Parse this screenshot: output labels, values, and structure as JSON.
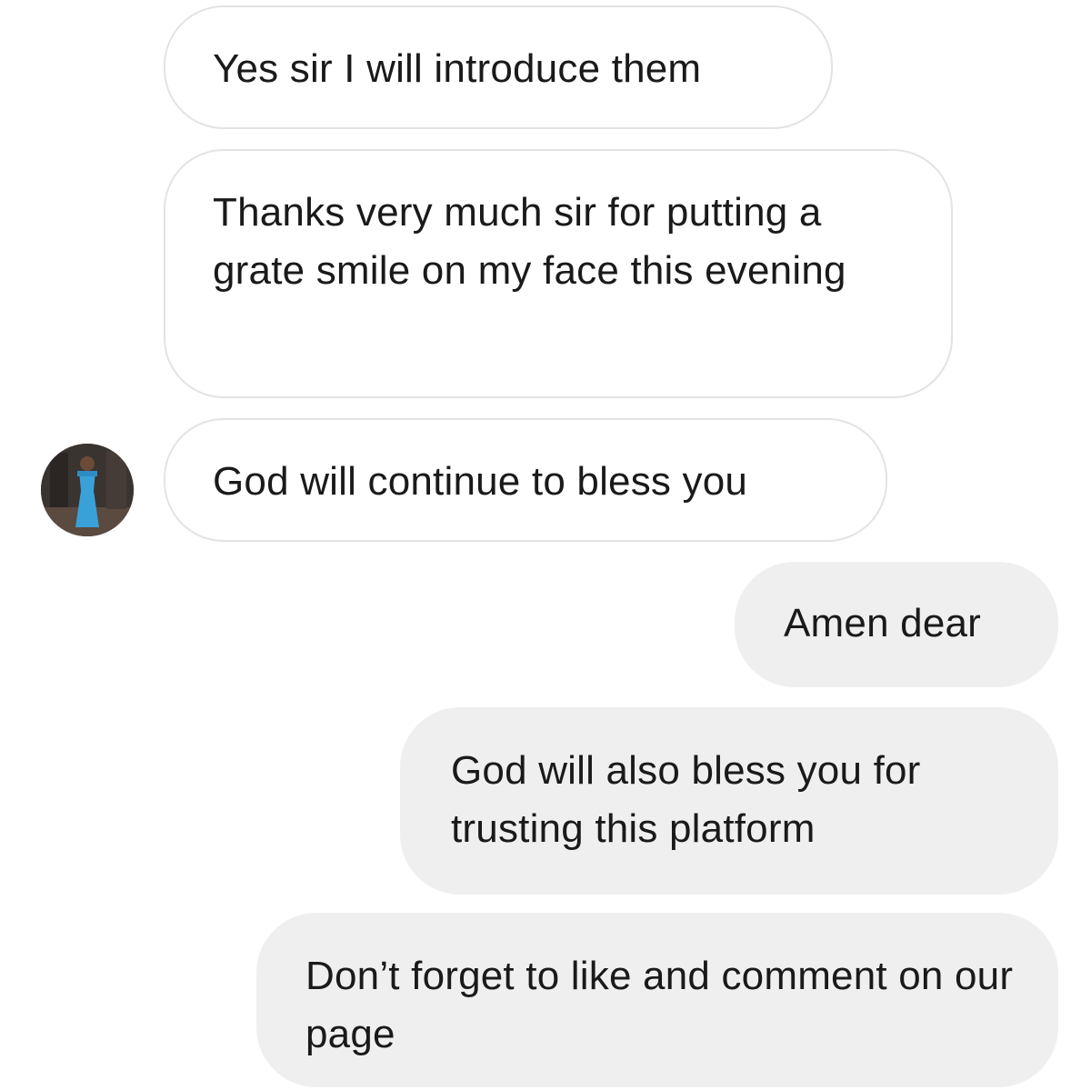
{
  "messages": [
    {
      "direction": "incoming",
      "text": "Yes sir I will introduce them"
    },
    {
      "direction": "incoming",
      "text": "Thanks very much sir for putting a grate smile on my face this evening"
    },
    {
      "direction": "incoming",
      "text": "God will continue to bless you",
      "has_avatar": true
    },
    {
      "direction": "outgoing",
      "text": "Amen dear"
    },
    {
      "direction": "outgoing",
      "text": "God will also bless you for trusting this platform"
    },
    {
      "direction": "outgoing",
      "text": "Don’t forget to like and comment on our page"
    }
  ],
  "colors": {
    "incoming_bg": "#ffffff",
    "incoming_border": "#e3e3e3",
    "outgoing_bg": "#efefef",
    "text": "#1a1a1a",
    "avatar_dress": "#3aa0d8"
  }
}
